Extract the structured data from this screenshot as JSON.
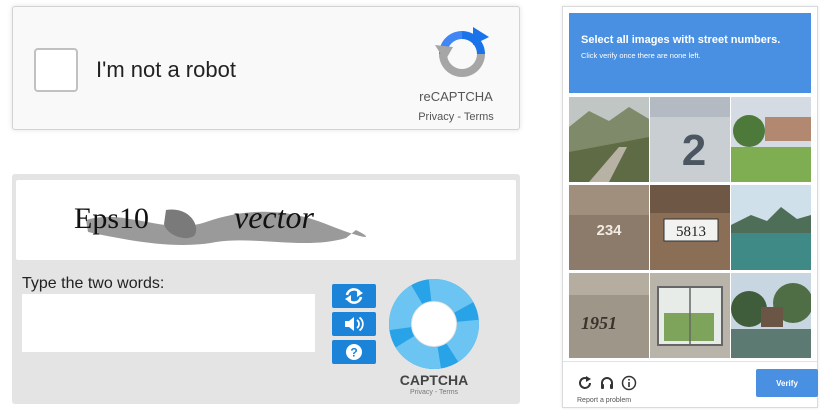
{
  "recaptcha": {
    "checkbox_label": "I'm not a robot",
    "brand": "reCAPTCHA",
    "privacy_link": "Privacy",
    "separator": " - ",
    "terms_link": "Terms"
  },
  "text_captcha": {
    "distorted_words": [
      "Eps10",
      "vector"
    ],
    "prompt": "Type the two words:",
    "input_value": "",
    "buttons": [
      "refresh-icon",
      "audio-icon",
      "help-icon"
    ],
    "brand": "CAPTCHA",
    "privacy_link": "Privacy",
    "separator": " - ",
    "terms_link": "Terms"
  },
  "image_challenge": {
    "instruction_prefix": "Select all images with ",
    "instruction_emphasis": "street numbers.",
    "subinstruction": "Click verify once there are none left.",
    "tiles": [
      {
        "content": "hillside road"
      },
      {
        "content": "house number",
        "number": "2"
      },
      {
        "content": "green lawn"
      },
      {
        "content": "house number",
        "number": "234"
      },
      {
        "content": "house number",
        "number": "5813"
      },
      {
        "content": "lake and hills"
      },
      {
        "content": "house number",
        "number": "1951"
      },
      {
        "content": "window with plants"
      },
      {
        "content": "trees by water"
      }
    ],
    "tools": [
      "reload-icon",
      "headphones-icon",
      "info-icon"
    ],
    "report_link": "Report a problem",
    "verify_button": "Verify"
  },
  "colors": {
    "recaptcha_blue": "#1a73e8",
    "challenge_header": "#4a90e2",
    "captcha_button": "#1b83d8",
    "captcha_ring": "#29a3e8"
  }
}
